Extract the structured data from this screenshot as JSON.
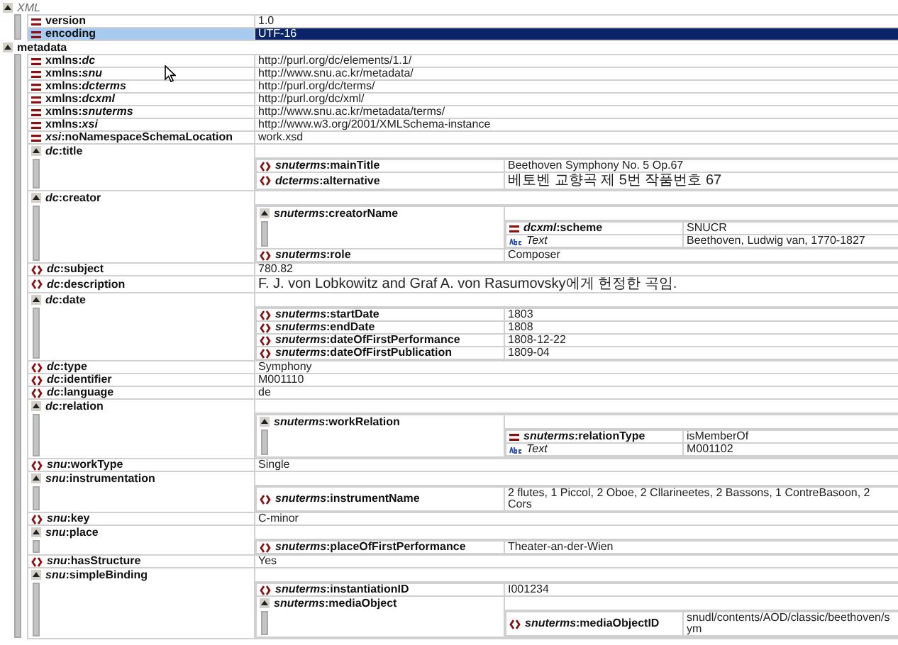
{
  "document": [
    {
      "kind": "declaration",
      "name": "XML",
      "expanded": true,
      "children": [
        {
          "kind": "attribute",
          "name": "version",
          "value": "1.0"
        },
        {
          "kind": "attribute",
          "name": "encoding",
          "value": "UTF-16",
          "selected": true
        }
      ]
    },
    {
      "kind": "group",
      "name": "metadata",
      "expanded": true,
      "children": [
        {
          "kind": "attribute",
          "name": "xmlns:*dc*",
          "value": "http://purl.org/dc/elements/1.1/"
        },
        {
          "kind": "attribute",
          "name": "xmlns:*snu*",
          "value": "http://www.snu.ac.kr/metadata/"
        },
        {
          "kind": "attribute",
          "name": "xmlns:*dcterms*",
          "value": "http://purl.org/dc/terms/"
        },
        {
          "kind": "attribute",
          "name": "xmlns:*dcxml*",
          "value": "http://purl.org/dc/xml/"
        },
        {
          "kind": "attribute",
          "name": "xmlns:*snuterms*",
          "value": "http://www.snu.ac.kr/metadata/terms/"
        },
        {
          "kind": "attribute",
          "name": "xmlns:*xsi*",
          "value": "http://www.w3.org/2001/XMLSchema-instance"
        },
        {
          "kind": "attribute",
          "name": "*xsi*:noNamespaceSchemaLocation",
          "value": "work.xsd"
        },
        {
          "kind": "group",
          "name": "*dc*:title",
          "expanded": true,
          "children": [
            {
              "kind": "element",
              "name": "*snuterms*:mainTitle",
              "value": "Beethoven Symphony No. 5 Op.67"
            },
            {
              "kind": "element",
              "name": "*dcterms*:alternative",
              "value": "베토벤 교향곡 제 5번 작품번호 67"
            }
          ]
        },
        {
          "kind": "group",
          "name": "*dc*:creator",
          "expanded": true,
          "children": [
            {
              "kind": "group",
              "name": "*snuterms*:creatorName",
              "expanded": true,
              "children": [
                {
                  "kind": "attribute",
                  "name": "*dcxml*:scheme",
                  "value": "SNUCR"
                },
                {
                  "kind": "text",
                  "name": "Text",
                  "value": "Beethoven, Ludwig van, 1770-1827"
                }
              ]
            },
            {
              "kind": "element",
              "name": "*snuterms*:role",
              "value": "Composer"
            }
          ]
        },
        {
          "kind": "element",
          "name": "*dc*:subject",
          "value": "780.82"
        },
        {
          "kind": "element",
          "name": "*dc*:description",
          "value": "F. J. von Lobkowitz and Graf A. von Rasumovsky에게 헌정한 곡임."
        },
        {
          "kind": "group",
          "name": "*dc*:date",
          "expanded": true,
          "children": [
            {
              "kind": "element",
              "name": "*snuterms*:startDate",
              "value": "1803"
            },
            {
              "kind": "element",
              "name": "*snuterms*:endDate",
              "value": "1808"
            },
            {
              "kind": "element",
              "name": "*snuterms*:dateOfFirstPerformance",
              "value": "1808-12-22"
            },
            {
              "kind": "element",
              "name": "*snuterms*:dateOfFirstPublication",
              "value": "1809-04"
            }
          ]
        },
        {
          "kind": "element",
          "name": "*dc*:type",
          "value": "Symphony"
        },
        {
          "kind": "element",
          "name": "*dc*:identifier",
          "value": "M001110"
        },
        {
          "kind": "element",
          "name": "*dc*:language",
          "value": "de"
        },
        {
          "kind": "group",
          "name": "*dc*:relation",
          "expanded": true,
          "children": [
            {
              "kind": "group",
              "name": "*snuterms*:workRelation",
              "expanded": true,
              "children": [
                {
                  "kind": "attribute",
                  "name": "*snuterms*:relationType",
                  "value": "isMemberOf"
                },
                {
                  "kind": "text",
                  "name": "Text",
                  "value": "M001102"
                }
              ]
            }
          ]
        },
        {
          "kind": "element",
          "name": "*snu*:workType",
          "value": "Single"
        },
        {
          "kind": "group",
          "name": "*snu*:instrumentation",
          "expanded": true,
          "children": [
            {
              "kind": "element",
              "name": "*snuterms*:instrumentName",
              "value": "2 flutes, 1 Piccol, 2 Oboe, 2 Cllarineetes, 2 Bassons, 1 ContreBasoon, 2 Cors"
            }
          ]
        },
        {
          "kind": "element",
          "name": "*snu*:key",
          "value": "C-minor"
        },
        {
          "kind": "group",
          "name": "*snu*:place",
          "expanded": true,
          "children": [
            {
              "kind": "element",
              "name": "*snuterms*:placeOfFirstPerformance",
              "value": "Theater-an-der-Wien"
            }
          ]
        },
        {
          "kind": "element",
          "name": "*snu*:hasStructure",
          "value": "Yes"
        },
        {
          "kind": "group",
          "name": "*snu*:simpleBinding",
          "expanded": true,
          "children": [
            {
              "kind": "element",
              "name": "*snuterms*:instantiationID",
              "value": "I001234"
            },
            {
              "kind": "group",
              "name": "*snuterms*:mediaObject",
              "expanded": true,
              "children": [
                {
                  "kind": "element",
                  "name": "*snuterms*:mediaObjectID",
                  "value": "snudl/contents/AOD/classic/beethoven/sym"
                }
              ]
            }
          ]
        }
      ]
    }
  ]
}
